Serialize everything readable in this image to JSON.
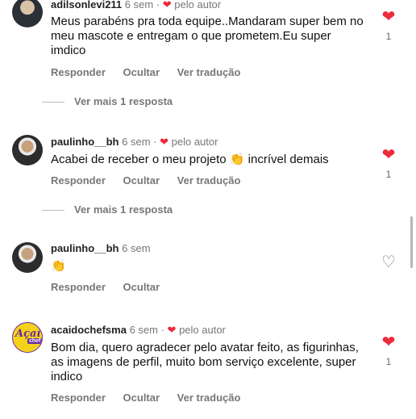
{
  "like_color": "#ed2a3b",
  "comments": [
    {
      "username": "adilsonlevi211",
      "time": "6 sem",
      "author_liked": true,
      "author_label": "pelo autor",
      "text": "Meus parabéns pra toda equipe..Mandaram super bem no meu mascote e entregam o que prometem.Eu super imdico",
      "actions": [
        "Responder",
        "Ocultar",
        "Ver tradução"
      ],
      "likes": "1",
      "liked": true,
      "more": "Ver mais 1 resposta"
    },
    {
      "username": "paulinho__bh",
      "time": "6 sem",
      "author_liked": true,
      "author_label": "pelo autor",
      "text": "Acabei de receber o meu projeto 👏 incrível demais",
      "actions": [
        "Responder",
        "Ocultar",
        "Ver tradução"
      ],
      "likes": "1",
      "liked": true,
      "more": "Ver mais 1 resposta"
    },
    {
      "username": "paulinho__bh",
      "time": "6 sem",
      "author_liked": false,
      "text": "👏",
      "actions": [
        "Responder",
        "Ocultar"
      ],
      "liked": false
    },
    {
      "username": "acaidochefsma",
      "time": "6 sem",
      "author_liked": true,
      "author_label": "pelo autor",
      "text": "Bom dia, quero agradecer pelo avatar feito, as figurinhas, as imagens de perfil, muito bom serviço excelente, super indico",
      "actions": [
        "Responder",
        "Ocultar",
        "Ver tradução"
      ],
      "likes": "1",
      "liked": true,
      "avatar_text": [
        "Açaí",
        "chef"
      ]
    }
  ]
}
